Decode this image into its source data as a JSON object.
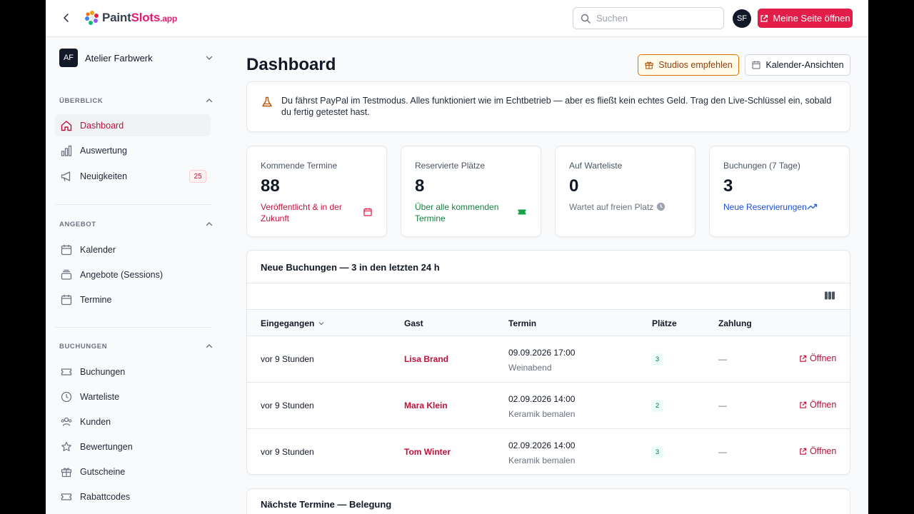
{
  "topbar": {
    "logo": {
      "paint": "Paint",
      "slots": "Slots",
      "app": ".app"
    },
    "search_placeholder": "Suchen",
    "user_initials": "SF",
    "primary_button": "Meine Seite öffnen"
  },
  "sidebar": {
    "org": {
      "initials": "AF",
      "name": "Atelier Farbwerk"
    },
    "sections": [
      {
        "label": "ÜBERBLICK",
        "items": [
          {
            "label": "Dashboard",
            "icon": "home-icon",
            "active": true
          },
          {
            "label": "Auswertung",
            "icon": "bar-chart-icon"
          },
          {
            "label": "Neuigkeiten",
            "icon": "megaphone-icon",
            "badge": "25"
          }
        ]
      },
      {
        "label": "ANGEBOT",
        "items": [
          {
            "label": "Kalender",
            "icon": "calendar-icon"
          },
          {
            "label": "Angebote (Sessions)",
            "icon": "layers-icon"
          },
          {
            "label": "Termine",
            "icon": "calendar-icon"
          }
        ]
      },
      {
        "label": "BUCHUNGEN",
        "items": [
          {
            "label": "Buchungen",
            "icon": "ticket-icon"
          },
          {
            "label": "Warteliste",
            "icon": "clock-icon"
          },
          {
            "label": "Kunden",
            "icon": "users-icon"
          },
          {
            "label": "Bewertungen",
            "icon": "star-icon"
          },
          {
            "label": "Gutscheine",
            "icon": "gift-icon"
          },
          {
            "label": "Rabattcodes",
            "icon": "ticket-icon"
          }
        ]
      }
    ]
  },
  "main": {
    "title": "Dashboard",
    "recommend_button": "Studios empfehlen",
    "calendar_views_button": "Kalender-Ansichten",
    "notice": "Du fährst PayPal im Testmodus. Alles funktioniert wie im Echtbetrieb — aber es fließt kein echtes Geld. Trag den Live-Schlüssel ein, sobald du fertig getestet hast.",
    "stats": [
      {
        "label": "Kommende Termine",
        "value": "88",
        "sub": "Veröffentlicht & in der Zukunft",
        "color": "#be123c",
        "icon": "calendar-icon"
      },
      {
        "label": "Reservierte Plätze",
        "value": "8",
        "sub": "Über alle kommenden Termine",
        "color": "#15803d",
        "icon": "ticket-icon"
      },
      {
        "label": "Auf Warteliste",
        "value": "0",
        "sub": "Wartet auf freien Platz",
        "color": "#6b7280",
        "icon": "clock-icon"
      },
      {
        "label": "Buchungen (7 Tage)",
        "value": "3",
        "sub": "Neue Reservierungen",
        "color": "#1d4ed8",
        "icon": "trending-up-icon"
      }
    ],
    "bookings": {
      "title": "Neue Buchungen — 3 in den letzten 24 h",
      "columns": [
        "Eingegangen",
        "Gast",
        "Termin",
        "Plätze",
        "Zahlung"
      ],
      "open_label": "Öffnen",
      "rows": [
        {
          "received": "vor 9 Stunden",
          "guest": "Lisa Brand",
          "date": "09.09.2026 17:00",
          "event": "Weinabend",
          "seats": "3",
          "payment": "—"
        },
        {
          "received": "vor 9 Stunden",
          "guest": "Mara Klein",
          "date": "02.09.2026 14:00",
          "event": "Keramik bemalen",
          "seats": "2",
          "payment": "—"
        },
        {
          "received": "vor 9 Stunden",
          "guest": "Tom Winter",
          "date": "02.09.2026 14:00",
          "event": "Keramik bemalen",
          "seats": "3",
          "payment": "—"
        }
      ]
    },
    "next_card_title": "Nächste Termine — Belegung"
  }
}
